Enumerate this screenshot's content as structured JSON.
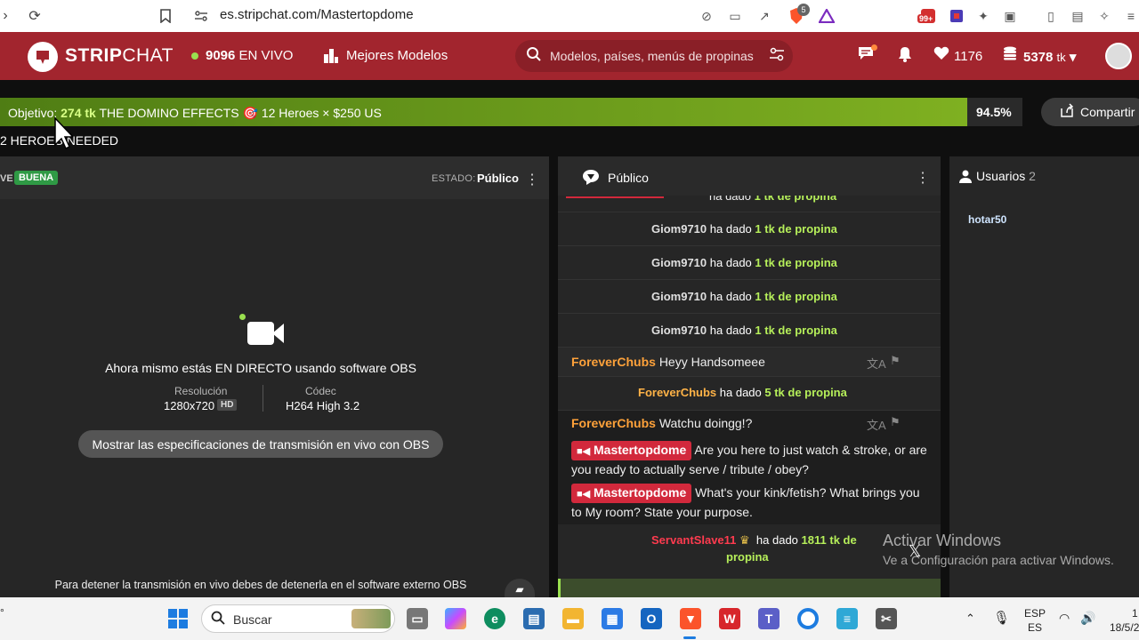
{
  "browser": {
    "url": "es.stripchat.com/Mastertopdome",
    "brave_badge": "5",
    "ext_badge": "99+"
  },
  "header": {
    "logo_bold": "STRIP",
    "logo_light": "CHAT",
    "live_count": "9096",
    "live_label": "EN VIVO",
    "best_models": "Mejores Modelos",
    "search_placeholder": "Modelos, países, menús de propinas",
    "favorites": "1176",
    "tokens": "5378",
    "tokens_unit": "tk"
  },
  "goal": {
    "prefix": "Objetivo:",
    "amount": "274 tk",
    "text": "THE DOMINO EFFECTS",
    "extra": "12 Heroes × $250 US",
    "progress": 0.945,
    "percent_label": "94.5%",
    "share_label": "Compartir",
    "heroes_needed": "2 HEROES NEEDED"
  },
  "video": {
    "live_small": "VE",
    "quality_badge": "BUENA",
    "estado_label": "ESTADO:",
    "estado_value": "Público",
    "live_message": "Ahora mismo estás EN DIRECTO usando software OBS",
    "resolution_label": "Resolución",
    "resolution_value": "1280x720",
    "hd_badge": "HD",
    "codec_label": "Códec",
    "codec_value": "H264 High 3.2",
    "obs_button": "Mostrar las especificaciones de transmisión en vivo con OBS",
    "stop_message": "Para detener la transmisión en vivo debes de detenerla en el software externo OBS"
  },
  "chat": {
    "title": "Público",
    "tips": [
      {
        "user": "Giom9710",
        "verb": "ha dado",
        "amount": "1 tk de propina"
      },
      {
        "user": "Giom9710",
        "verb": "ha dado",
        "amount": "1 tk de propina"
      },
      {
        "user": "Giom9710",
        "verb": "ha dado",
        "amount": "1 tk de propina"
      },
      {
        "user": "Giom9710",
        "verb": "ha dado",
        "amount": "1 tk de propina"
      }
    ],
    "partial_tip_amount": "1 tk de propina",
    "msg1": {
      "user": "ForeverChubs",
      "text": "Heyy Handsomeee"
    },
    "tip5": {
      "user": "ForeverChubs",
      "verb": "ha dado",
      "amount": "5 tk de propina"
    },
    "msg2": {
      "user": "ForeverChubs",
      "text": "Watchu doingg!?"
    },
    "model_msg1": {
      "user": "Mastertopdome",
      "text": "Are you here to just watch & stroke, or are you ready to actually serve / tribute / obey?"
    },
    "model_msg2": {
      "user": "Mastertopdome",
      "text": "What's your kink/fetish? What brings you to My room? State your purpose."
    },
    "big_tip": {
      "user": "ServantSlave11",
      "verb": "ha dado",
      "amount_line1": "1811 tk de",
      "amount_line2": "propina"
    }
  },
  "users": {
    "title": "Usuarios",
    "count": "2",
    "list": [
      "hotar50"
    ]
  },
  "watermark": {
    "line1": "Activar Windows",
    "line2": "Ve a Configuración para activar Windows."
  },
  "taskbar": {
    "search_label": "Buscar",
    "lang_top": "ESP",
    "lang_bottom": "ES",
    "time_partial": "1",
    "date_partial": "18/5/2"
  },
  "colors": {
    "brand_red": "#a2252e",
    "goal_green": "#7fb021",
    "tip_green": "#b6ef5a",
    "user_orange": "#ffa23a",
    "model_red": "#d2293c"
  }
}
